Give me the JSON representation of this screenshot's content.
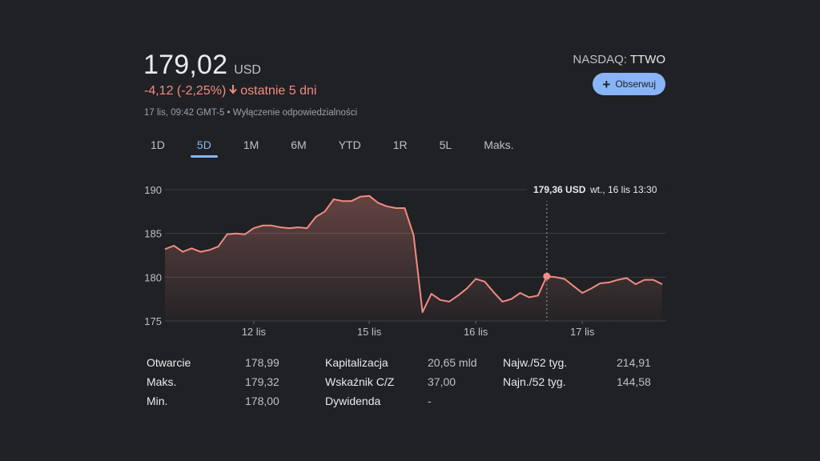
{
  "header": {
    "price": "179,02",
    "currency": "USD",
    "change": "-4,12 (-2,25%)",
    "change_period": "ostatnie 5 dni",
    "meta": "17 lis, 09:42 GMT-5 • Wyłączenie odpowiedzialności",
    "exchange": "NASDAQ:",
    "ticker": "TTWO",
    "follow_label": "Obserwuj"
  },
  "tabs": [
    {
      "label": "1D"
    },
    {
      "label": "5D"
    },
    {
      "label": "1M"
    },
    {
      "label": "6M"
    },
    {
      "label": "YTD"
    },
    {
      "label": "1R"
    },
    {
      "label": "5L"
    },
    {
      "label": "Maks."
    }
  ],
  "active_tab": "5D",
  "colors": {
    "line": "#f28b82",
    "accent": "#8ab4f8",
    "negative": "#f28b82",
    "background": "#202124"
  },
  "tooltip": {
    "price": "179,36 USD",
    "date": "wt., 16 lis 13:30"
  },
  "chart_data": {
    "type": "area",
    "ylim": [
      175,
      190
    ],
    "yticks": [
      "190",
      "185",
      "180",
      "175"
    ],
    "ytick_values": [
      190,
      185,
      180,
      175
    ],
    "xlabels": [
      "12 lis",
      "15 lis",
      "16 lis",
      "17 lis"
    ],
    "xlabel_index": [
      10,
      23,
      35,
      47
    ],
    "hover_index": 43,
    "values": [
      183.2,
      183.6,
      182.9,
      183.3,
      182.9,
      183.1,
      183.5,
      184.9,
      185.0,
      184.9,
      185.6,
      185.9,
      185.9,
      185.7,
      185.6,
      185.7,
      185.6,
      186.9,
      187.5,
      188.9,
      188.7,
      188.7,
      189.2,
      189.3,
      188.5,
      188.1,
      187.9,
      187.9,
      184.8,
      176.0,
      178.1,
      177.4,
      177.2,
      177.9,
      178.7,
      179.8,
      179.5,
      178.3,
      177.2,
      177.5,
      178.2,
      177.7,
      177.9,
      180.1,
      180.0,
      179.8,
      179.0,
      178.2,
      178.7,
      179.3,
      179.4,
      179.7,
      179.9,
      179.2,
      179.7,
      179.7,
      179.2
    ]
  },
  "stats": {
    "col1": [
      {
        "label": "Otwarcie",
        "value": "178,99"
      },
      {
        "label": "Maks.",
        "value": "179,32"
      },
      {
        "label": "Min.",
        "value": "178,00"
      }
    ],
    "col2": [
      {
        "label": "Kapitalizacja",
        "value": "20,65 mld"
      },
      {
        "label": "Wskaźnik C/Z",
        "value": "37,00"
      },
      {
        "label": "Dywidenda",
        "value": "-"
      }
    ],
    "col3": [
      {
        "label": "Najw./52 tyg.",
        "value": "214,91"
      },
      {
        "label": "Najn./52 tyg.",
        "value": "144,58"
      }
    ]
  }
}
